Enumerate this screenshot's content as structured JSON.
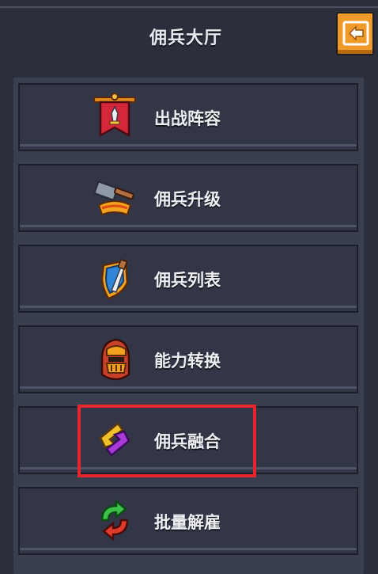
{
  "header": {
    "title": "佣兵大厅",
    "back_icon": "back-arrow-icon"
  },
  "menu": {
    "items": [
      {
        "label": "出战阵容",
        "icon": "banner-sword-icon"
      },
      {
        "label": "佣兵升级",
        "icon": "hammer-icon"
      },
      {
        "label": "佣兵列表",
        "icon": "shield-sword-icon"
      },
      {
        "label": "能力转换",
        "icon": "helmet-icon"
      },
      {
        "label": "佣兵融合",
        "icon": "fusion-icon"
      },
      {
        "label": "批量解雇",
        "icon": "recycle-icon"
      }
    ]
  },
  "colors": {
    "accent": "#f09a2a",
    "highlight": "#e8252c",
    "panel": "#3a3f4f",
    "button": "#323647"
  }
}
